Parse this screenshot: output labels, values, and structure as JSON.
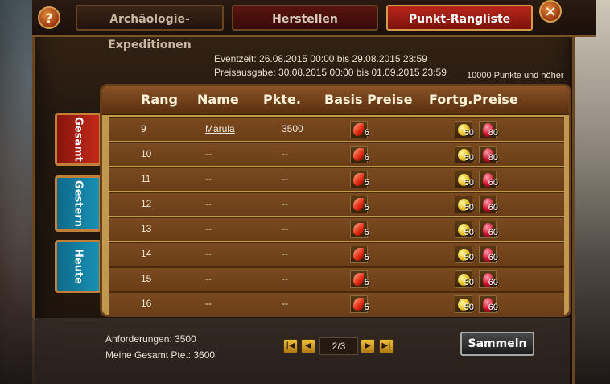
{
  "tabs": {
    "archaeology": "Archäologie-Expeditionen",
    "crafting": "Herstellen",
    "ranking": "Punkt-Rangliste"
  },
  "buttons": {
    "help": "?",
    "close": "×",
    "collect": "Sammeln"
  },
  "event": {
    "time": "Eventzeit: 26.08.2015 00:00 bis 29.08.2015 23:59",
    "payout": "Preisausgabe: 30.08.2015 00:00 bis 01.09.2015 23:59",
    "threshold": "10000 Punkte und höher"
  },
  "side_tabs": {
    "total": "Gesamt",
    "yesterday": "Gestern",
    "today": "Heute"
  },
  "table": {
    "headers": {
      "rank": "Rang",
      "name": "Name",
      "points": "Pkte.",
      "base": "Basis Preise",
      "advanced": "Fortg.Preise"
    },
    "rows": [
      {
        "rank": "9",
        "name": "Marula",
        "points": "3500",
        "base": "6",
        "coin": "50",
        "ruby": "80"
      },
      {
        "rank": "10",
        "name": "--",
        "points": "--",
        "base": "6",
        "coin": "50",
        "ruby": "80"
      },
      {
        "rank": "11",
        "name": "--",
        "points": "--",
        "base": "5",
        "coin": "50",
        "ruby": "60"
      },
      {
        "rank": "12",
        "name": "--",
        "points": "--",
        "base": "5",
        "coin": "50",
        "ruby": "60"
      },
      {
        "rank": "13",
        "name": "--",
        "points": "--",
        "base": "5",
        "coin": "50",
        "ruby": "60"
      },
      {
        "rank": "14",
        "name": "--",
        "points": "--",
        "base": "5",
        "coin": "50",
        "ruby": "60"
      },
      {
        "rank": "15",
        "name": "--",
        "points": "--",
        "base": "5",
        "coin": "50",
        "ruby": "60"
      },
      {
        "rank": "16",
        "name": "--",
        "points": "--",
        "base": "5",
        "coin": "50",
        "ruby": "60"
      }
    ]
  },
  "footer": {
    "requirements": "Anforderungen: 3500",
    "my_points": "Meine Gesamt Pte.: 3600",
    "page": "2/3"
  },
  "icons": {
    "base_prize": "flame-petal-icon",
    "coin": "gold-coin-icon",
    "ruby": "ruby-icon"
  }
}
